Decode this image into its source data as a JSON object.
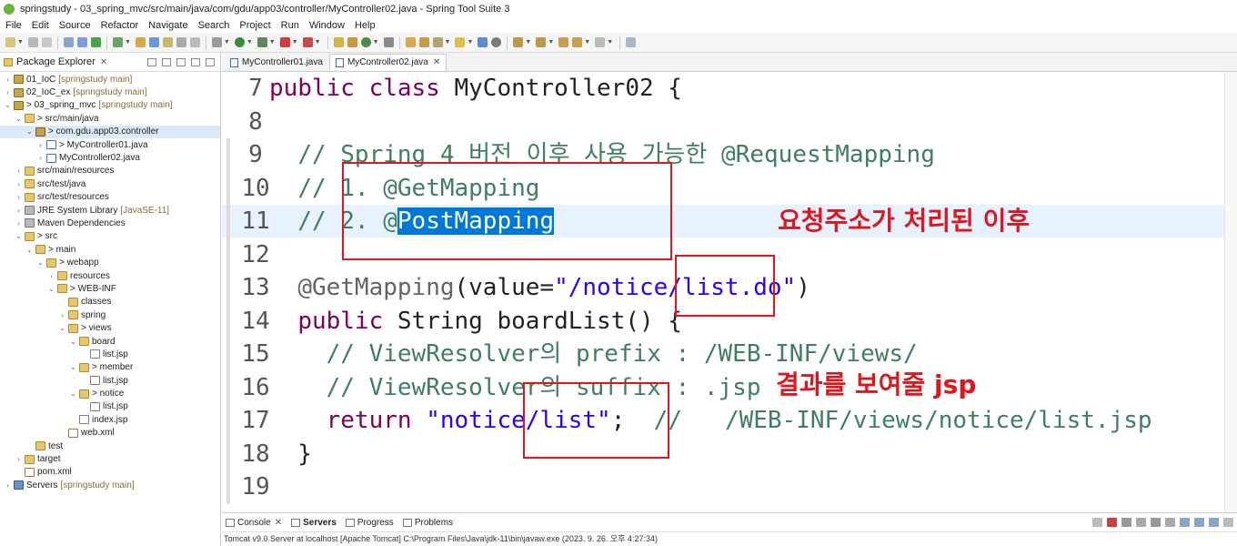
{
  "window": {
    "title": "springstudy - 03_spring_mvc/src/main/java/com/gdu/app03/controller/MyController02.java - Spring Tool Suite 3"
  },
  "menu": [
    "File",
    "Edit",
    "Source",
    "Refactor",
    "Navigate",
    "Search",
    "Project",
    "Run",
    "Window",
    "Help"
  ],
  "explorer": {
    "tab_label": "Package Explorer",
    "tree": [
      {
        "label": "01_IoC",
        "dec": "[springstudy main]",
        "depth": 0,
        "tw": ">",
        "icon": "proj"
      },
      {
        "label": "02_IoC_ex",
        "dec": "[springstudy main]",
        "depth": 0,
        "tw": ">",
        "icon": "proj"
      },
      {
        "label": "> 03_spring_mvc",
        "dec": "[springstudy main]",
        "depth": 0,
        "tw": "v",
        "icon": "proj"
      },
      {
        "label": "> src/main/java",
        "dec": "",
        "depth": 1,
        "tw": "v",
        "icon": "folder"
      },
      {
        "label": "> com.gdu.app03.controller",
        "dec": "",
        "depth": 2,
        "tw": "v",
        "icon": "pkg",
        "selected": true
      },
      {
        "label": "> MyController01.java",
        "dec": "",
        "depth": 3,
        "tw": ">",
        "icon": "java"
      },
      {
        "label": "MyController02.java",
        "dec": "",
        "depth": 3,
        "tw": ">",
        "icon": "java"
      },
      {
        "label": "src/main/resources",
        "dec": "",
        "depth": 1,
        "tw": ">",
        "icon": "folder"
      },
      {
        "label": "src/test/java",
        "dec": "",
        "depth": 1,
        "tw": ">",
        "icon": "folder"
      },
      {
        "label": "src/test/resources",
        "dec": "",
        "depth": 1,
        "tw": ">",
        "icon": "folder"
      },
      {
        "label": "JRE System Library",
        "dec": "[JavaSE-11]",
        "depth": 1,
        "tw": ">",
        "icon": "lib"
      },
      {
        "label": "Maven Dependencies",
        "dec": "",
        "depth": 1,
        "tw": ">",
        "icon": "lib"
      },
      {
        "label": "> src",
        "dec": "",
        "depth": 1,
        "tw": "v",
        "icon": "folder"
      },
      {
        "label": "> main",
        "dec": "",
        "depth": 2,
        "tw": "v",
        "icon": "folder"
      },
      {
        "label": "> webapp",
        "dec": "",
        "depth": 3,
        "tw": "v",
        "icon": "folder"
      },
      {
        "label": "resources",
        "dec": "",
        "depth": 4,
        "tw": ">",
        "icon": "folder"
      },
      {
        "label": "> WEB-INF",
        "dec": "",
        "depth": 4,
        "tw": "v",
        "icon": "folder"
      },
      {
        "label": "classes",
        "dec": "",
        "depth": 5,
        "tw": "",
        "icon": "folder"
      },
      {
        "label": "spring",
        "dec": "",
        "depth": 5,
        "tw": ">",
        "icon": "folder"
      },
      {
        "label": "> views",
        "dec": "",
        "depth": 5,
        "tw": "v",
        "icon": "folder"
      },
      {
        "label": "board",
        "dec": "",
        "depth": 6,
        "tw": "v",
        "icon": "folder"
      },
      {
        "label": "list.jsp",
        "dec": "",
        "depth": 7,
        "tw": "",
        "icon": "jsp"
      },
      {
        "label": "> member",
        "dec": "",
        "depth": 6,
        "tw": "v",
        "icon": "folder"
      },
      {
        "label": "list.jsp",
        "dec": "",
        "depth": 7,
        "tw": "",
        "icon": "jsp"
      },
      {
        "label": "> notice",
        "dec": "",
        "depth": 6,
        "tw": "v",
        "icon": "folder"
      },
      {
        "label": "list.jsp",
        "dec": "",
        "depth": 7,
        "tw": "",
        "icon": "jsp"
      },
      {
        "label": "index.jsp",
        "dec": "",
        "depth": 6,
        "tw": "",
        "icon": "jsp"
      },
      {
        "label": "web.xml",
        "dec": "",
        "depth": 5,
        "tw": "",
        "icon": "xml"
      },
      {
        "label": "test",
        "dec": "",
        "depth": 2,
        "tw": "",
        "icon": "folder"
      },
      {
        "label": "target",
        "dec": "",
        "depth": 1,
        "tw": ">",
        "icon": "folder"
      },
      {
        "label": "pom.xml",
        "dec": "",
        "depth": 1,
        "tw": "",
        "icon": "xml"
      },
      {
        "label": "Servers",
        "dec": "[springstudy main]",
        "depth": 0,
        "tw": ">",
        "icon": "server"
      }
    ]
  },
  "editor": {
    "tabs": [
      {
        "label": "MyController01.java",
        "active": false
      },
      {
        "label": "MyController02.java",
        "active": true
      }
    ],
    "lines": [
      {
        "n": "7",
        "parts": [
          [
            "kw",
            "public class "
          ],
          [
            "tx",
            "MyController02 {"
          ]
        ]
      },
      {
        "n": "8",
        "parts": []
      },
      {
        "n": "9",
        "parts": [
          [
            "tx",
            "  "
          ],
          [
            "cm",
            "// Spring 4 버전 이후 사용 가능한 @RequestMapping"
          ]
        ]
      },
      {
        "n": "10",
        "parts": [
          [
            "tx",
            "  "
          ],
          [
            "cm",
            "// 1. @GetMapping"
          ]
        ]
      },
      {
        "n": "11",
        "parts": [
          [
            "tx",
            "  "
          ],
          [
            "cm",
            "// 2. @"
          ],
          [
            "sel",
            "PostMapping"
          ]
        ],
        "highlight": true
      },
      {
        "n": "12",
        "parts": []
      },
      {
        "n": "13",
        "parts": [
          [
            "tx",
            "  "
          ],
          [
            "an",
            "@GetMapping"
          ],
          [
            "tx",
            "(value="
          ],
          [
            "st",
            "\"/notice/list.do\""
          ],
          [
            "tx",
            ")"
          ]
        ]
      },
      {
        "n": "14",
        "parts": [
          [
            "tx",
            "  "
          ],
          [
            "kw",
            "public "
          ],
          [
            "tx",
            "String boardList() {"
          ]
        ]
      },
      {
        "n": "15",
        "parts": [
          [
            "tx",
            "    "
          ],
          [
            "cm",
            "// ViewResolver의 prefix : /WEB-INF/views/"
          ]
        ]
      },
      {
        "n": "16",
        "parts": [
          [
            "tx",
            "    "
          ],
          [
            "cm",
            "// ViewResolver의 suffix : .jsp"
          ]
        ]
      },
      {
        "n": "17",
        "parts": [
          [
            "tx",
            "    "
          ],
          [
            "kw",
            "return "
          ],
          [
            "st",
            "\"notice/list\""
          ],
          [
            "tx",
            ";  "
          ],
          [
            "cm",
            "//   /WEB-INF/views/notice/list.jsp"
          ]
        ]
      },
      {
        "n": "18",
        "parts": [
          [
            "tx",
            "  }"
          ]
        ]
      },
      {
        "n": "19",
        "parts": []
      }
    ],
    "annotations": [
      {
        "text": "요청주소가 처리된 이후",
        "id": "annotation-request-handled"
      },
      {
        "text": "결과를 보여줄 jsp",
        "id": "annotation-result-jsp"
      }
    ]
  },
  "bottom_panel": {
    "tabs": [
      {
        "label": "Console",
        "active": false
      },
      {
        "label": "Servers",
        "active": true
      },
      {
        "label": "Progress",
        "active": false
      },
      {
        "label": "Problems",
        "active": false
      }
    ],
    "status": "Tomcat v9.0 Server at localhost [Apache Tomcat] C:\\Program Files\\Java\\jdk-11\\bin\\javaw.exe  (2023. 9. 26. 오후 4:27:34)"
  },
  "colors": {
    "keyword": "#7f0055",
    "comment": "#3f7f5f",
    "string": "#2a00ff",
    "annotation": "#646464",
    "selection": "#0078d7",
    "markup_red": "#e0161c"
  }
}
